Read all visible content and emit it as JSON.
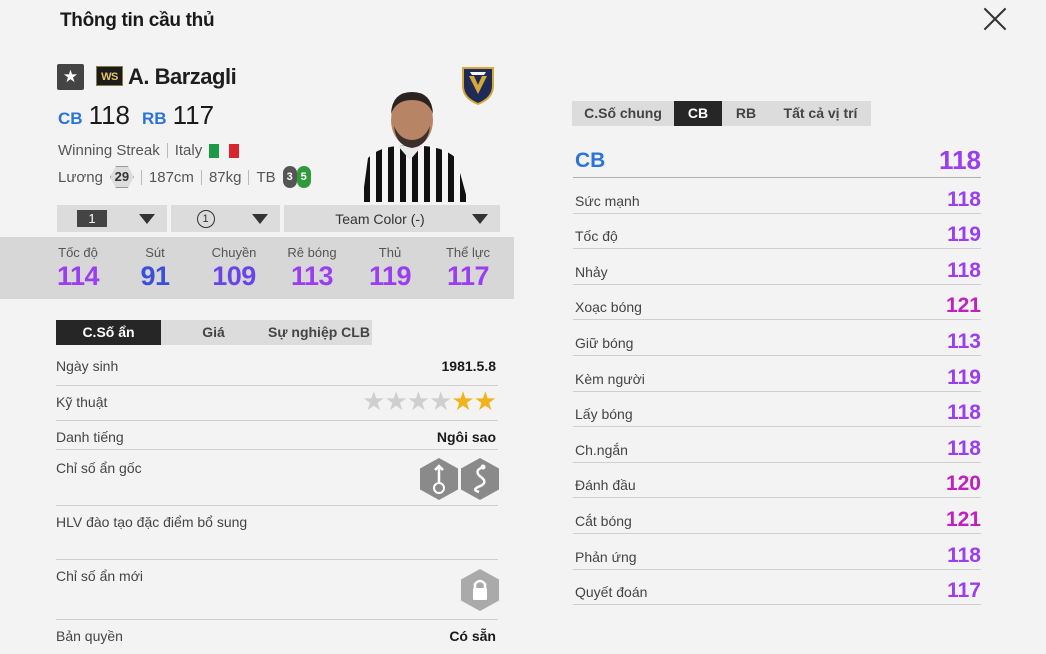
{
  "title": "Thông tin cầu thủ",
  "player": {
    "name": "A. Barzagli",
    "season": "WS",
    "positions": [
      {
        "pos": "CB",
        "ovr": "118"
      },
      {
        "pos": "RB",
        "ovr": "117"
      }
    ],
    "season_name": "Winning Streak",
    "nation": "Italy",
    "salary_label": "Lương",
    "salary": "29",
    "height": "187cm",
    "weight": "87kg",
    "body": "TB",
    "skill_moves": "3",
    "weak_foot": "5"
  },
  "dropdowns": {
    "upgrade": "1",
    "team_color_level": "1",
    "team_color": "Team Color (-)"
  },
  "summary": [
    {
      "label": "Tốc độ",
      "value": "114",
      "color": "#9b3df0"
    },
    {
      "label": "Sút",
      "value": "91",
      "color": "#3b4fd8"
    },
    {
      "label": "Chuyền",
      "value": "109",
      "color": "#6a44e8"
    },
    {
      "label": "Rê bóng",
      "value": "113",
      "color": "#9b3df0"
    },
    {
      "label": "Thủ",
      "value": "119",
      "color": "#9b3df0"
    },
    {
      "label": "Thể lực",
      "value": "117",
      "color": "#9b3df0"
    }
  ],
  "left_tabs": [
    "C.Số ẩn",
    "Giá",
    "Sự nghiệp CLB"
  ],
  "details": {
    "birth_label": "Ngày sinh",
    "birth": "1981.5.8",
    "skill_label": "Kỹ thuật",
    "skill_stars": 2,
    "fame_label": "Danh tiếng",
    "fame": "Ngôi sao",
    "traits_label": "Chỉ số ẩn gốc",
    "coach_label": "HLV đào tạo đặc điểm bổ sung",
    "new_traits_label": "Chỉ số ẩn mới",
    "license_label": "Bản quyền",
    "license": "Có sẵn"
  },
  "right_tabs": [
    "C.Số chung",
    "CB",
    "RB",
    "Tất cả vị trí"
  ],
  "position_header": {
    "label": "CB",
    "value": "118"
  },
  "attributes": [
    {
      "label": "Sức mạnh",
      "value": "118",
      "tone": "purple"
    },
    {
      "label": "Tốc độ",
      "value": "119",
      "tone": "purple"
    },
    {
      "label": "Nhảy",
      "value": "118",
      "tone": "purple"
    },
    {
      "label": "Xoạc bóng",
      "value": "121",
      "tone": "magenta"
    },
    {
      "label": "Giữ bóng",
      "value": "113",
      "tone": "purple"
    },
    {
      "label": "Kèm người",
      "value": "119",
      "tone": "purple"
    },
    {
      "label": "Lấy bóng",
      "value": "118",
      "tone": "purple"
    },
    {
      "label": "Ch.ngắn",
      "value": "118",
      "tone": "purple"
    },
    {
      "label": "Đánh đầu",
      "value": "120",
      "tone": "magenta"
    },
    {
      "label": "Cắt bóng",
      "value": "121",
      "tone": "magenta"
    },
    {
      "label": "Phản ứng",
      "value": "118",
      "tone": "purple"
    },
    {
      "label": "Quyết đoán",
      "value": "117",
      "tone": "purple"
    }
  ],
  "colors": {
    "cb_blue": "#2a74d9",
    "purple": "#9b3df0",
    "magenta": "#c21fc1",
    "star_on": "#f2b21c",
    "star_off": "#cfcfcf"
  }
}
